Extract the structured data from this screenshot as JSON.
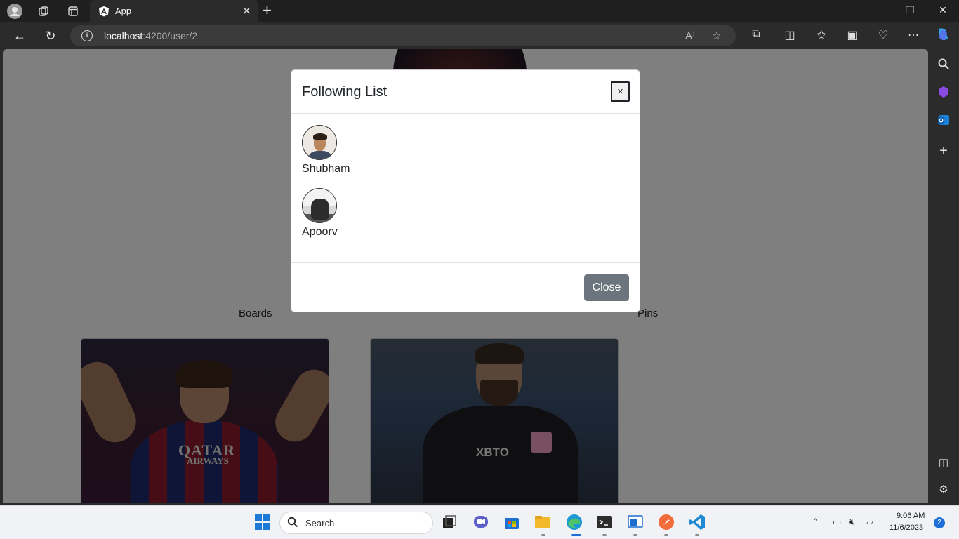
{
  "browser": {
    "tab_title": "App",
    "url_host": "localhost",
    "url_rest": ":4200/user/2",
    "icons": [
      "profile-icon",
      "workspaces-icon",
      "tab-actions-icon",
      "close-icon",
      "new-tab-icon",
      "back-icon",
      "refresh-icon",
      "info-icon",
      "read-aloud-icon",
      "favorite-star-icon",
      "extensions-icon",
      "split-screen-icon",
      "favorites-icon",
      "collections-icon",
      "browser-essentials-icon",
      "more-icon",
      "copilot-icon"
    ],
    "read_aloud_label": "A⁾"
  },
  "page": {
    "boards_label": "Boards",
    "pins_label": "Pins",
    "card1_sponsor": "QATAR",
    "card1_sponsor2": "AIRWAYS",
    "card2_sponsor": "XBTO"
  },
  "modal": {
    "title": "Following List",
    "close_x": "×",
    "users": [
      {
        "name": "Shubham"
      },
      {
        "name": "Apoorv"
      }
    ],
    "close_label": "Close"
  },
  "taskbar": {
    "search_placeholder": "Search",
    "time": "9:06 AM",
    "date": "11/6/2023",
    "notification_count": "2"
  },
  "colors": {
    "close_button": "#6c757d",
    "backdrop": "rgba(0,0,0,0.5)",
    "browser_chrome": "#2b2b2b"
  }
}
